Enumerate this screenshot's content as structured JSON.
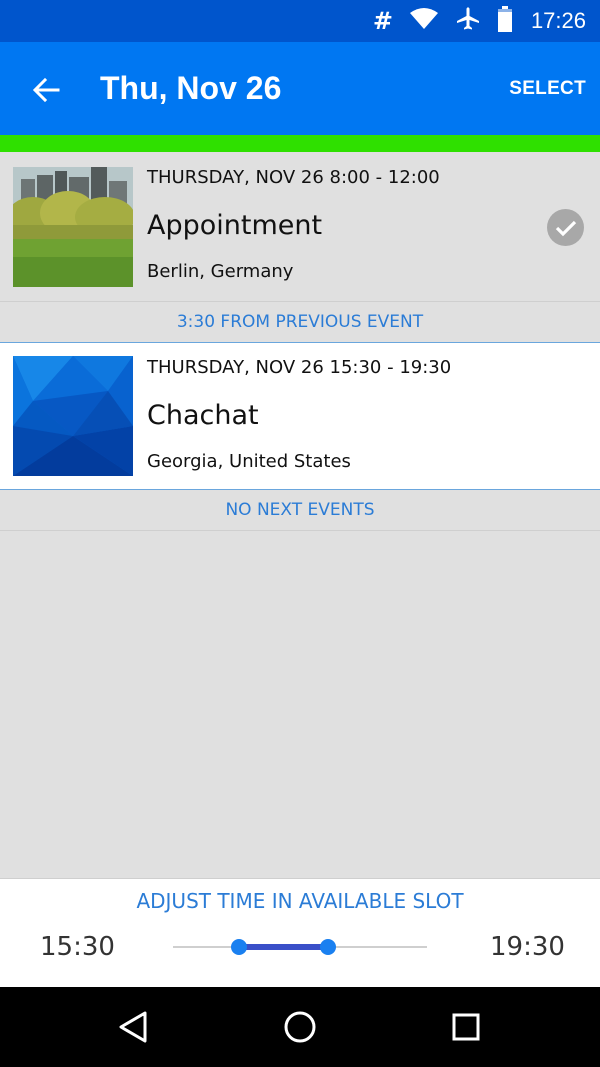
{
  "status_bar": {
    "time": "17:26",
    "icons": [
      "hash-icon",
      "wifi-icon",
      "airplane-mode-icon",
      "battery-icon"
    ],
    "hash_glyph": "#"
  },
  "app_bar": {
    "title": "Thu, Nov 26",
    "action_label": "SELECT",
    "color": "#0077f2"
  },
  "accent_color": "#2fe000",
  "events": [
    {
      "when": "THURSDAY, NOV 26  8:00 - 12:00",
      "name": "Appointment",
      "place": "Berlin, Germany",
      "completed": true,
      "thumbnail": "park-with-buildings"
    },
    {
      "when": "THURSDAY, NOV 26  15:30 - 19:30",
      "name": "Chachat",
      "place": "Georgia, United States",
      "completed": false,
      "thumbnail": "blue-polygon-pattern"
    }
  ],
  "gaps": {
    "previous": "3:30 FROM PREVIOUS EVENT",
    "next": "NO NEXT EVENTS"
  },
  "adjust": {
    "title": "ADJUST TIME IN AVAILABLE SLOT",
    "start": "15:30",
    "end": "19:30",
    "range_start_fraction": 0.26,
    "range_end_fraction": 0.61
  },
  "nav_bar": {
    "icons": [
      "back-triangle-icon",
      "home-circle-icon",
      "recents-square-icon"
    ]
  },
  "link_color": "#2b7cd6"
}
